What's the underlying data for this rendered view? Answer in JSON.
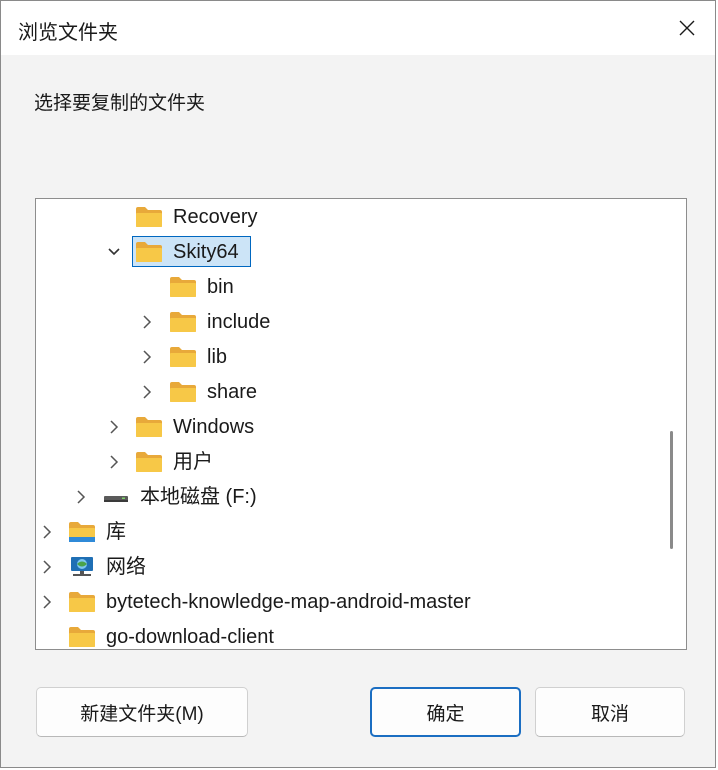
{
  "dialog": {
    "title": "浏览文件夹",
    "prompt": "选择要复制的文件夹"
  },
  "tree": {
    "items": [
      {
        "label": "Recovery",
        "icon": "folder-icon",
        "expander": "none",
        "selected": false
      },
      {
        "label": "Skity64",
        "icon": "folder-icon",
        "expander": "expanded",
        "selected": true
      },
      {
        "label": "bin",
        "icon": "folder-icon",
        "expander": "none",
        "selected": false
      },
      {
        "label": "include",
        "icon": "folder-icon",
        "expander": "collapsed",
        "selected": false
      },
      {
        "label": "lib",
        "icon": "folder-icon",
        "expander": "collapsed",
        "selected": false
      },
      {
        "label": "share",
        "icon": "folder-icon",
        "expander": "collapsed",
        "selected": false
      },
      {
        "label": "Windows",
        "icon": "folder-icon",
        "expander": "collapsed",
        "selected": false
      },
      {
        "label": "用户",
        "icon": "folder-icon",
        "expander": "collapsed",
        "selected": false
      },
      {
        "label": "本地磁盘 (F:)",
        "icon": "drive-icon",
        "expander": "collapsed",
        "selected": false
      },
      {
        "label": "库",
        "icon": "library-icon",
        "expander": "collapsed",
        "selected": false
      },
      {
        "label": "网络",
        "icon": "network-icon",
        "expander": "collapsed",
        "selected": false
      },
      {
        "label": "bytetech-knowledge-map-android-master",
        "icon": "folder-icon",
        "expander": "collapsed",
        "selected": false
      },
      {
        "label": "go-download-client",
        "icon": "folder-icon",
        "expander": "none",
        "selected": false
      }
    ]
  },
  "buttons": {
    "new_folder": "新建文件夹(M)",
    "ok": "确定",
    "cancel": "取消"
  },
  "colors": {
    "folder": "#f7c847",
    "folder_back": "#e8a93a",
    "selection_bg": "#cce4f7",
    "selection_border": "#0067c0",
    "primary_border": "#1b6ec2"
  }
}
